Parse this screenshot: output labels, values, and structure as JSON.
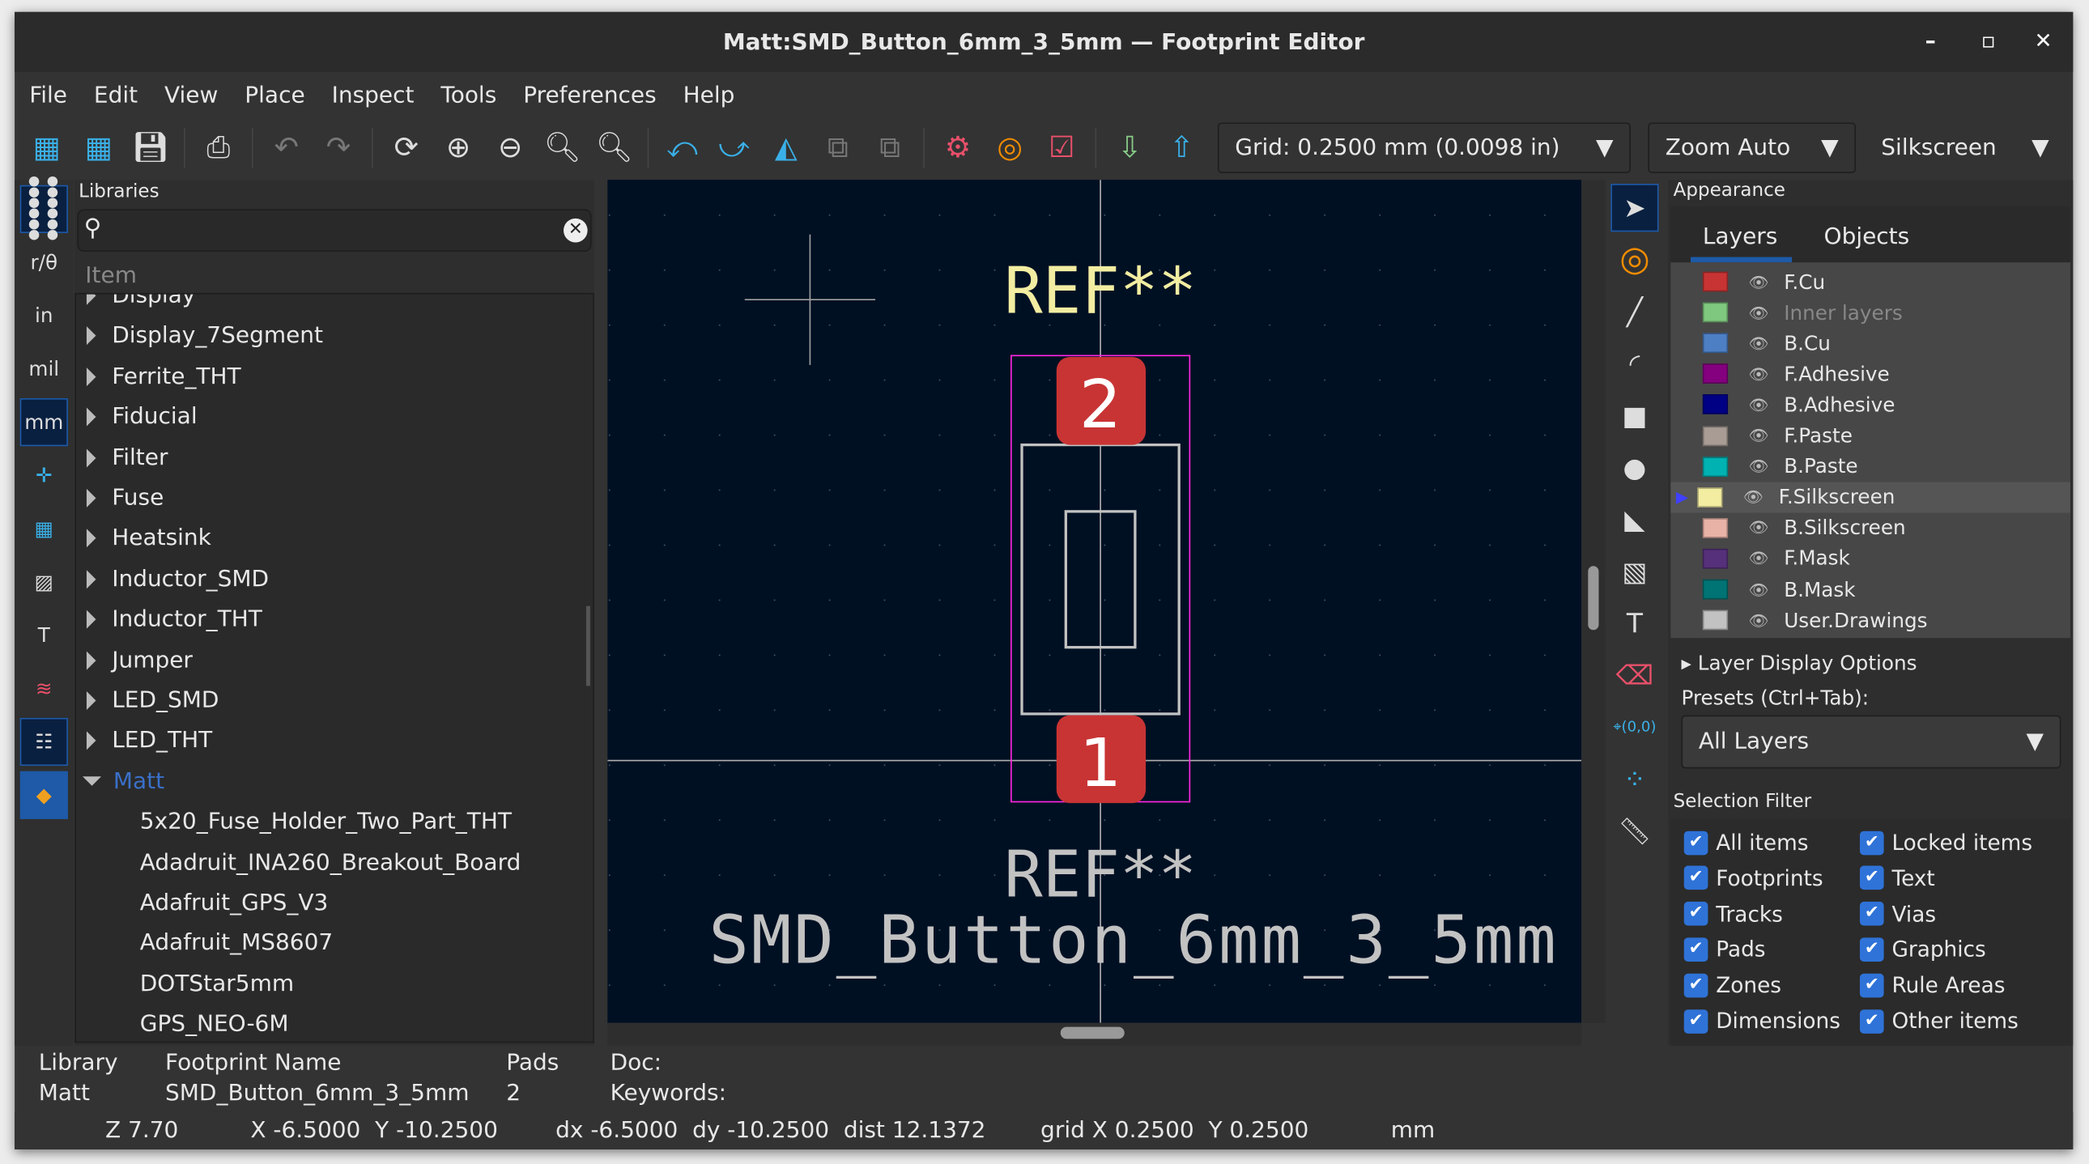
{
  "window": {
    "title": "Matt:SMD_Button_6mm_3_5mm — Footprint Editor",
    "minimize": "–",
    "maximize": "▫",
    "close": "✕"
  },
  "menu": [
    "File",
    "Edit",
    "View",
    "Place",
    "Inspect",
    "Tools",
    "Preferences",
    "Help"
  ],
  "toolbar": {
    "grid": "Grid: 0.2500 mm (0.0098 in)",
    "zoom": "Zoom Auto",
    "layer": "Silkscreen"
  },
  "left_toolbar": {
    "in": "in",
    "mil": "mil",
    "mm": "mm"
  },
  "libraries": {
    "title": "Libraries",
    "search_placeholder": "",
    "column": "Item",
    "items": [
      {
        "label": "Display",
        "expanded": false
      },
      {
        "label": "Display_7Segment",
        "expanded": false
      },
      {
        "label": "Ferrite_THT",
        "expanded": false
      },
      {
        "label": "Fiducial",
        "expanded": false
      },
      {
        "label": "Filter",
        "expanded": false
      },
      {
        "label": "Fuse",
        "expanded": false
      },
      {
        "label": "Heatsink",
        "expanded": false
      },
      {
        "label": "Inductor_SMD",
        "expanded": false
      },
      {
        "label": "Inductor_THT",
        "expanded": false
      },
      {
        "label": "Jumper",
        "expanded": false
      },
      {
        "label": "LED_SMD",
        "expanded": false
      },
      {
        "label": "LED_THT",
        "expanded": false
      },
      {
        "label": "Matt",
        "expanded": true
      }
    ],
    "children": [
      "5x20_Fuse_Holder_Two_Part_THT",
      "Adadruit_INA260_Breakout_Board",
      "Adafruit_GPS_V3",
      "Adafruit_MS8607",
      "DOTStar5mm",
      "GPS_NEO-6M"
    ]
  },
  "canvas": {
    "ref_top": "REF**",
    "pad1": "1",
    "pad2": "2",
    "ref_fab": "REF**",
    "value": "SMD_Button_6mm_3_5mm",
    "colors": {
      "background": "#001023",
      "silkscreen": "#f2eda1",
      "courtyard": "#ff26e2",
      "pad": "#c83434",
      "fab": "#c2c2c2"
    }
  },
  "appearance": {
    "title": "Appearance",
    "tabs": [
      "Layers",
      "Objects"
    ],
    "active_tab": "Layers",
    "layers": [
      {
        "name": "F.Cu",
        "color": "#c83434"
      },
      {
        "name": "Inner layers",
        "color": "#7fc87f",
        "dim": true
      },
      {
        "name": "B.Cu",
        "color": "#4d7fc4"
      },
      {
        "name": "F.Adhesive",
        "color": "#84007f"
      },
      {
        "name": "B.Adhesive",
        "color": "#000084"
      },
      {
        "name": "F.Paste",
        "color": "#a89c94"
      },
      {
        "name": "B.Paste",
        "color": "#00b2b2"
      },
      {
        "name": "F.Silkscreen",
        "color": "#f2eda1",
        "active": true
      },
      {
        "name": "B.Silkscreen",
        "color": "#e8b2a7"
      },
      {
        "name": "F.Mask",
        "color": "#56307a"
      },
      {
        "name": "B.Mask",
        "color": "#007474"
      },
      {
        "name": "User.Drawings",
        "color": "#c2c2c2"
      }
    ],
    "layer_display_options": "Layer Display Options",
    "presets_label": "Presets (Ctrl+Tab):",
    "preset": "All Layers",
    "selection_filter": "Selection Filter",
    "filters": [
      "All items",
      "Locked items",
      "Footprints",
      "Text",
      "Tracks",
      "Vias",
      "Pads",
      "Graphics",
      "Zones",
      "Rule Areas",
      "Dimensions",
      "Other items"
    ]
  },
  "info": {
    "library_label": "Library",
    "library": "Matt",
    "name_label": "Footprint Name",
    "name": "SMD_Button_6mm_3_5mm",
    "pads_label": "Pads",
    "pads": "2",
    "doc_label": "Doc:",
    "keywords_label": "Keywords:"
  },
  "status": {
    "zoom": "Z 7.70",
    "pos": "X -6.5000  Y -10.2500",
    "delta": "dx -6.5000  dy -10.2500  dist 12.1372",
    "grid": "grid X 0.2500  Y 0.2500",
    "units": "mm"
  }
}
